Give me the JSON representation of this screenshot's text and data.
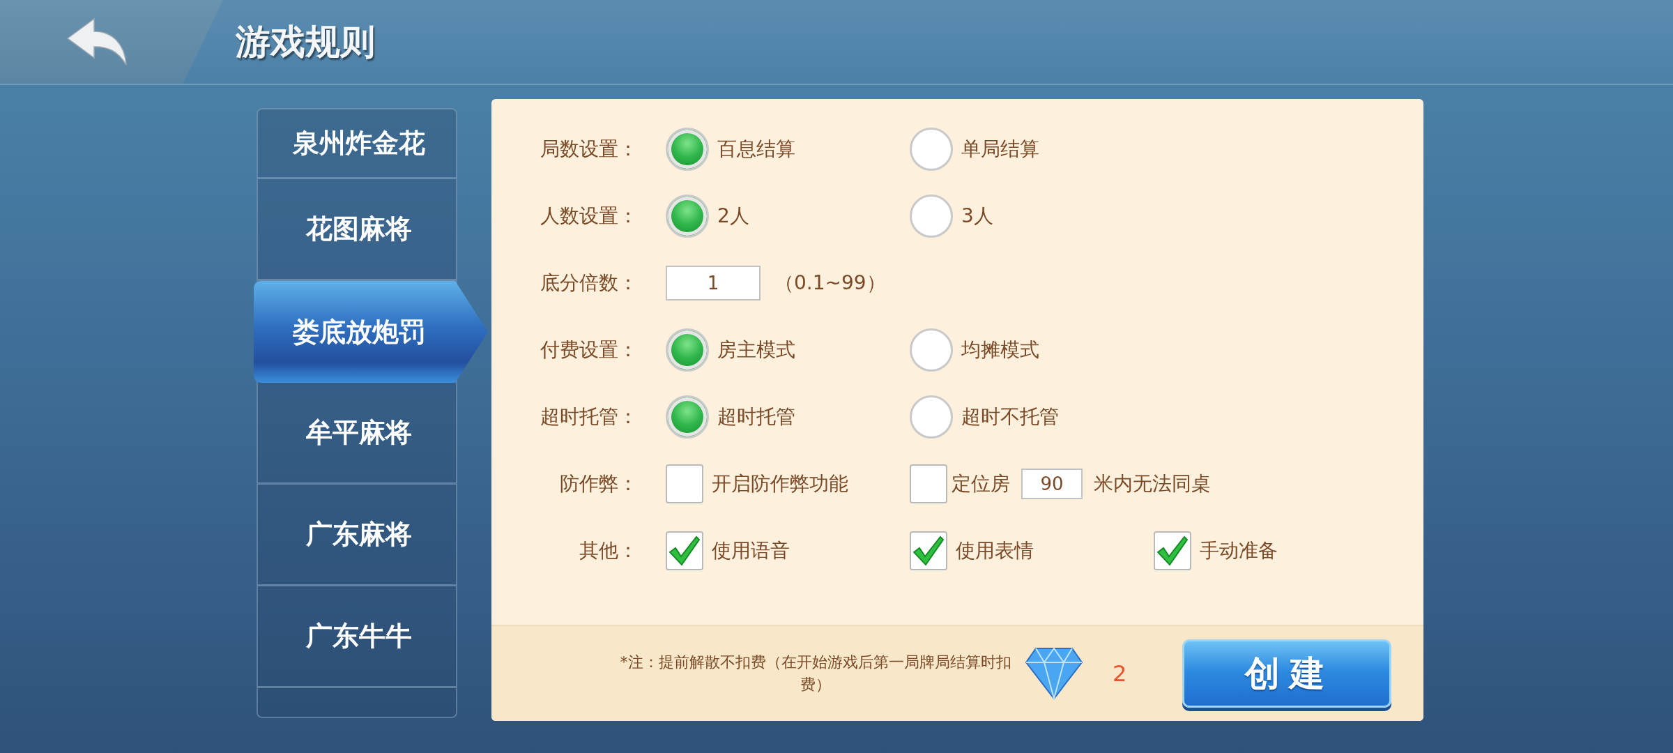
{
  "header": {
    "title": "游戏规则"
  },
  "sidebar": {
    "items": [
      {
        "label": "泉州炸金花",
        "selected": false
      },
      {
        "label": "花图麻将",
        "selected": false
      },
      {
        "label": "娄底放炮罚",
        "selected": true
      },
      {
        "label": "牟平麻将",
        "selected": false
      },
      {
        "label": "广东麻将",
        "selected": false
      },
      {
        "label": "广东牛牛",
        "selected": false
      }
    ]
  },
  "settings": [
    {
      "kind": "radio",
      "label": "局数设置：",
      "options": [
        {
          "label": "百息结算",
          "selected": true
        },
        {
          "label": "单局结算",
          "selected": false
        }
      ]
    },
    {
      "kind": "radio",
      "label": "人数设置：",
      "options": [
        {
          "label": "2人",
          "selected": true
        },
        {
          "label": "3人",
          "selected": false
        }
      ]
    },
    {
      "kind": "number",
      "label": "底分倍数：",
      "value": "1",
      "hint": "（0.1~99）"
    },
    {
      "kind": "radio",
      "label": "付费设置：",
      "options": [
        {
          "label": "房主模式",
          "selected": true
        },
        {
          "label": "均摊模式",
          "selected": false
        }
      ]
    },
    {
      "kind": "radio",
      "label": "超时托管：",
      "options": [
        {
          "label": "超时托管",
          "selected": true
        },
        {
          "label": "超时不托管",
          "selected": false
        }
      ]
    },
    {
      "kind": "checkbox",
      "label": "防作弊：",
      "options": [
        {
          "label": "开启防作弊功能",
          "checked": false
        },
        {
          "label": "定位房",
          "checked": false,
          "value": "90",
          "suffix": "米内无法同桌"
        }
      ]
    },
    {
      "kind": "checkbox",
      "label": "其他：",
      "options": [
        {
          "label": "使用语音",
          "checked": true
        },
        {
          "label": "使用表情",
          "checked": true
        },
        {
          "label": "手动准备",
          "checked": true
        }
      ]
    }
  ],
  "footer": {
    "note": "*注：提前解散不扣费（在开始游戏后第一局牌局结算时扣费）",
    "cost": "2",
    "create_button": "创建"
  }
}
